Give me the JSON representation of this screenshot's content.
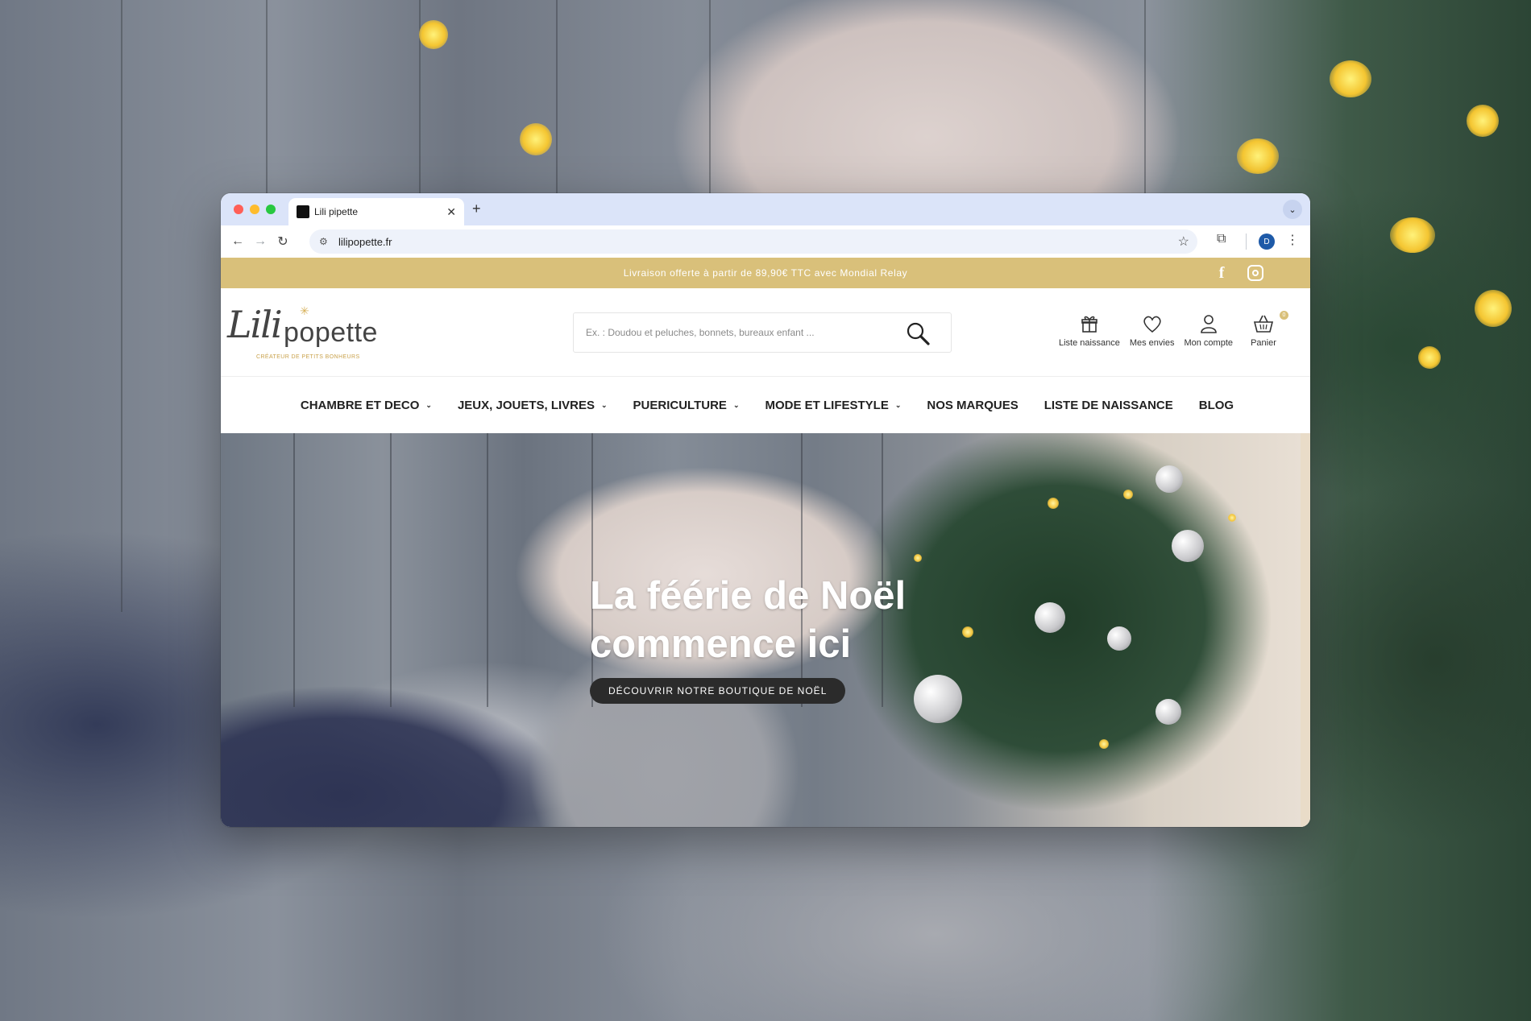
{
  "browser": {
    "tab": {
      "title": "Lili pipette"
    },
    "url": "lilipopette.fr",
    "profile_initial": "D"
  },
  "announcement": {
    "text": "Livraison offerte à partir de 89,90€ TTC avec Mondial Relay",
    "social": [
      "facebook-icon",
      "instagram-icon"
    ],
    "background": "#d9c07a"
  },
  "logo": {
    "script": "Lili",
    "word": "popette",
    "tagline": "CRÉATEUR DE PETITS BONHEURS"
  },
  "search": {
    "placeholder": "Ex. : Doudou et peluches, bonnets, bureaux enfant ..."
  },
  "header_actions": {
    "birth_list": "Liste naissance",
    "wishlist": "Mes envies",
    "account": "Mon compte",
    "cart": "Panier",
    "cart_count": "0"
  },
  "nav": {
    "items": [
      {
        "label": "CHAMBRE ET DECO",
        "has_dropdown": true
      },
      {
        "label": "JEUX, JOUETS, LIVRES",
        "has_dropdown": true
      },
      {
        "label": "PUERICULTURE",
        "has_dropdown": true
      },
      {
        "label": "MODE ET LIFESTYLE",
        "has_dropdown": true
      },
      {
        "label": "NOS MARQUES",
        "has_dropdown": false
      },
      {
        "label": "LISTE DE NAISSANCE",
        "has_dropdown": false
      },
      {
        "label": "BLOG",
        "has_dropdown": false
      }
    ]
  },
  "hero": {
    "title": "La féérie de Noël commence ici",
    "cta": "DÉCOUVRIR NOTRE BOUTIQUE DE NOËL"
  },
  "colors": {
    "accent_gold": "#d9c07a",
    "cta_dark": "#2b2b2b",
    "tab_strip": "#dbe4f9"
  }
}
